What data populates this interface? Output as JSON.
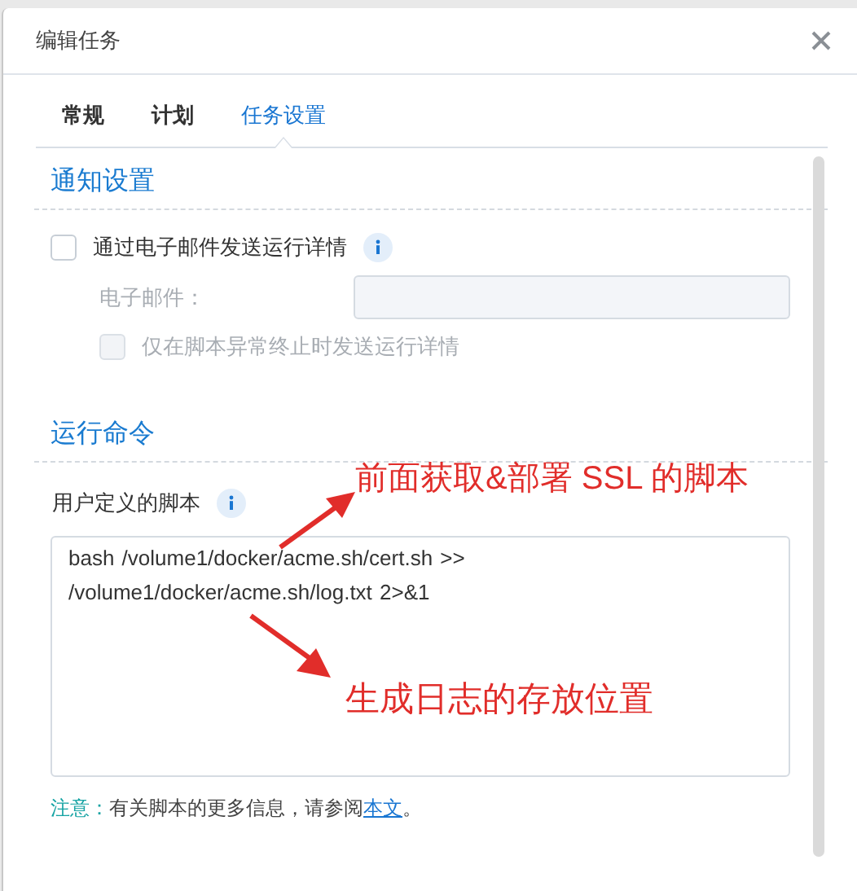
{
  "dialog": {
    "title": "编辑任务"
  },
  "tabs": [
    {
      "label": "常规",
      "selected": false
    },
    {
      "label": "计划",
      "selected": false
    },
    {
      "label": "任务设置",
      "selected": true
    }
  ],
  "notification": {
    "heading": "通知设置",
    "send_details": {
      "label": "通过电子邮件发送运行详情",
      "checked": false
    },
    "email": {
      "label": "电子邮件：",
      "disabled": true
    },
    "abnormal_only": {
      "label": "仅在脚本异常终止时发送运行详情",
      "checked": false,
      "disabled": true
    }
  },
  "command": {
    "heading": "运行命令",
    "script_label": "用户定义的脚本",
    "script": "bash  /volume1/docker/acme.sh/cert.sh >> /volume1/docker/acme.sh/log.txt 2>&1",
    "note": {
      "label": "注意：",
      "text": "有关脚本的更多信息，请参阅",
      "link": "本文",
      "end": "。"
    }
  },
  "annotations": [
    {
      "text": "前面获取&部署 SSL 的脚本"
    },
    {
      "text": "生成日志的存放位置"
    }
  ]
}
